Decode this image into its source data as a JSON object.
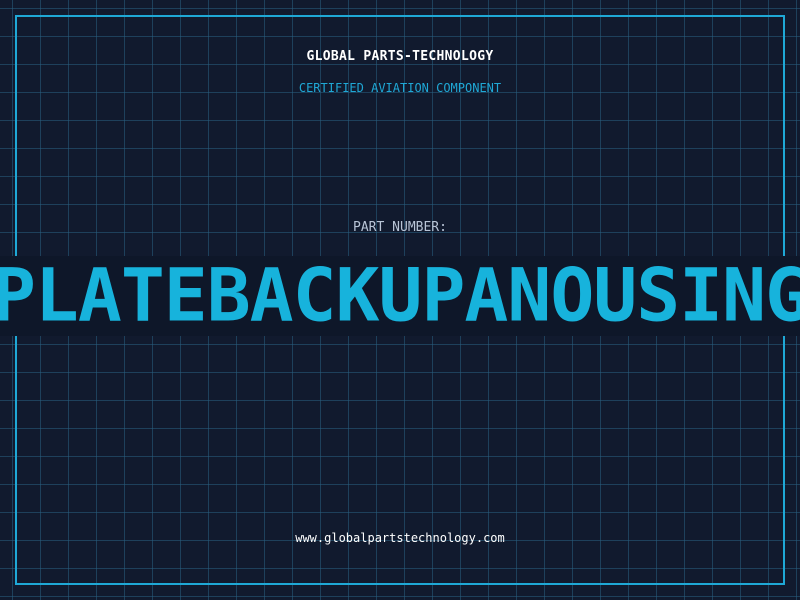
{
  "company_name": "GLOBAL PARTS-TECHNOLOGY",
  "subtitle": "CERTIFIED AVIATION COMPONENT",
  "part_number_label": "PART NUMBER:",
  "part_number_value": "PLATEBACKUPANOUSING",
  "website": "www.globalpartstechnology.com",
  "colors": {
    "background": "#111a2e",
    "grid": "#285f80",
    "accent": "#1fa8d6",
    "part_number": "#17b3dc",
    "text_primary": "#ffffff",
    "text_muted": "#b8c4d6"
  }
}
